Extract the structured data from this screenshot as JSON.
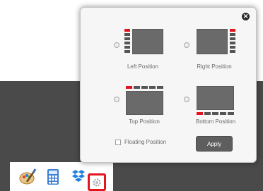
{
  "popup": {
    "close_icon": "close-icon",
    "options": [
      {
        "label": "Left Position"
      },
      {
        "label": "Right Position"
      },
      {
        "label": "Top Position"
      },
      {
        "label": "Bottom Position"
      }
    ],
    "floating_label": "Floating Position",
    "floating_checked": false,
    "apply_label": "Apply"
  },
  "taskbar": {
    "icons": [
      "paint-icon",
      "calculator-icon",
      "dropbox-icon",
      "settings-icon"
    ]
  },
  "colors": {
    "accent": "#e4141e",
    "preview": "#6a6a6a",
    "button": "#5e5e5e"
  }
}
